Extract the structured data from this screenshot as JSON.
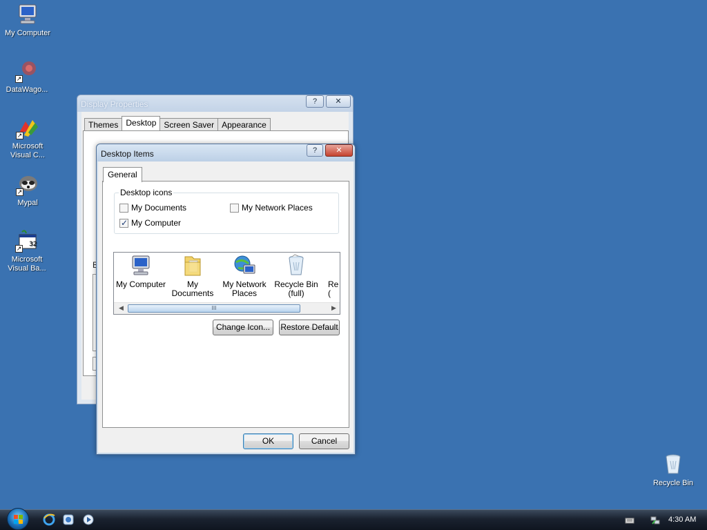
{
  "desktop": {
    "icons": [
      {
        "label": "My Computer",
        "icon": "computer-icon"
      },
      {
        "label": "DataWago...",
        "icon": "datawagon-icon"
      },
      {
        "label": "Microsoft Visual C...",
        "icon": "visual-c-icon"
      },
      {
        "label": "Mypal",
        "icon": "mypal-icon"
      },
      {
        "label": "Microsoft Visual Ba...",
        "icon": "visual-basic-icon"
      },
      {
        "label": "Recycle Bin",
        "icon": "recycle-bin-icon"
      }
    ]
  },
  "display_properties": {
    "title": "Display Properties",
    "help": "?",
    "close": "✕",
    "tabs": [
      "Themes",
      "Desktop",
      "Screen Saver",
      "Appearance"
    ],
    "active_tab": "Desktop",
    "partial_label": "B"
  },
  "desktop_items": {
    "title": "Desktop Items",
    "help": "?",
    "close": "✕",
    "tab": "General",
    "group_label": "Desktop icons",
    "checkboxes": [
      {
        "label": "My Documents",
        "checked": false
      },
      {
        "label": "My Network Places",
        "checked": false
      },
      {
        "label": "My Computer",
        "checked": true
      }
    ],
    "icon_list": [
      {
        "line1": "My Computer",
        "line2": "",
        "icon": "computer-icon"
      },
      {
        "line1": "My Documents",
        "line2": "",
        "icon": "folder-icon"
      },
      {
        "line1": "My Network",
        "line2": "Places",
        "icon": "network-places-icon"
      },
      {
        "line1": "Recycle Bin",
        "line2": "(full)",
        "icon": "recycle-bin-full-icon"
      },
      {
        "line1": "Re",
        "line2": "(",
        "icon": "recycle-bin-empty-icon"
      }
    ],
    "scroll_thumb": "III",
    "change_icon": "Change Icon...",
    "restore_default": "Restore Default",
    "ok": "OK",
    "cancel": "Cancel"
  },
  "taskbar": {
    "clock": "4:30 AM",
    "quick_launch": [
      "ie-icon",
      "media-icon",
      "player-icon"
    ]
  }
}
